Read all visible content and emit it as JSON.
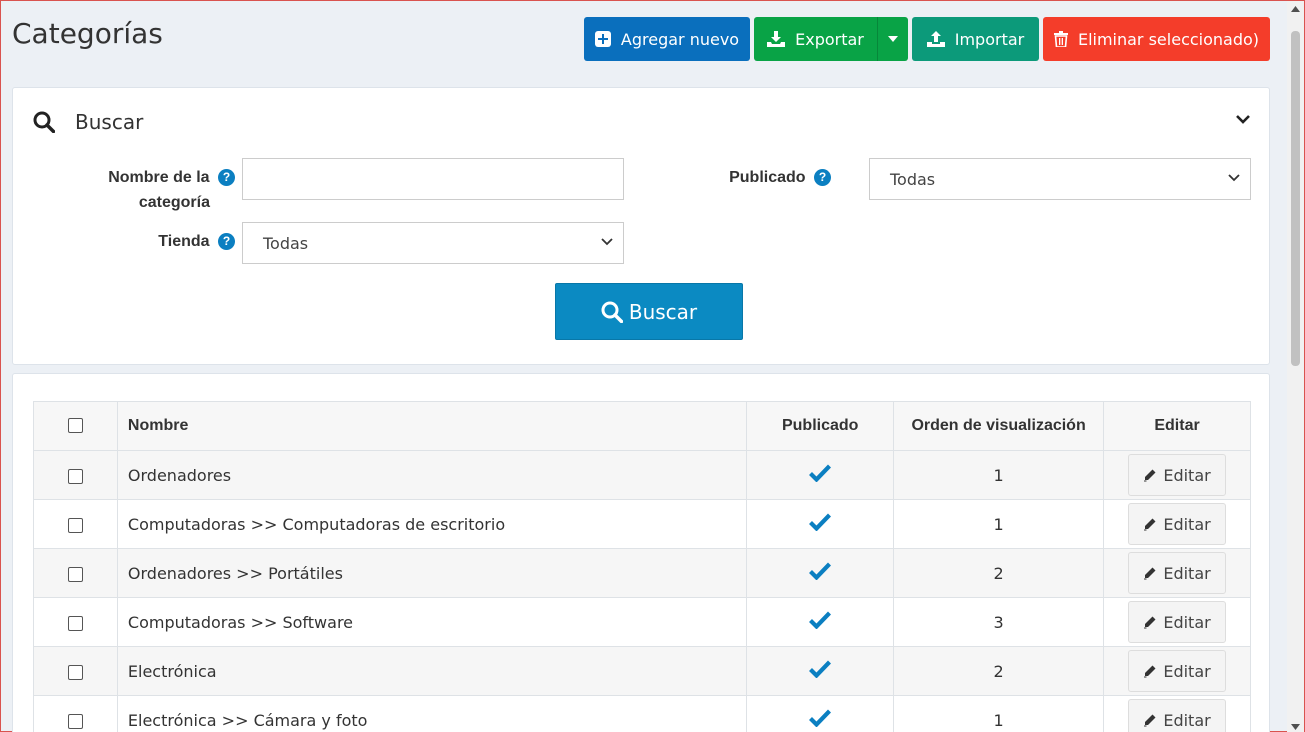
{
  "page": {
    "title": "Categorías"
  },
  "toolbar": {
    "add_label": "Agregar nuevo",
    "export_label": "Exportar",
    "import_label": "Importar",
    "delete_label": "Eliminar seleccionado)"
  },
  "search": {
    "title": "Buscar",
    "category_name_label_1": "Nombre de la",
    "category_name_label_2": "categoría",
    "category_name_value": "",
    "published_label": "Publicado",
    "published_value": "Todas",
    "store_label": "Tienda",
    "store_value": "Todas",
    "button_label": "Buscar",
    "help_glyph": "?"
  },
  "table": {
    "headers": {
      "name": "Nombre",
      "published": "Publicado",
      "display_order": "Orden de visualización",
      "edit": "Editar"
    },
    "edit_label": "Editar",
    "rows": [
      {
        "name": "Ordenadores",
        "published": true,
        "order": "1"
      },
      {
        "name": "Computadoras >> Computadoras de escritorio",
        "published": true,
        "order": "1"
      },
      {
        "name": "Ordenadores >> Portátiles",
        "published": true,
        "order": "2"
      },
      {
        "name": "Computadoras >> Software",
        "published": true,
        "order": "3"
      },
      {
        "name": "Electrónica",
        "published": true,
        "order": "2"
      },
      {
        "name": "Electrónica >> Cámara y foto",
        "published": true,
        "order": "1"
      }
    ]
  },
  "colors": {
    "primary": "#0a6fbd",
    "success": "#09a346",
    "import": "#0c9a7a",
    "danger": "#f43d2a",
    "search": "#0b8ac2",
    "check": "#0b7fc1"
  },
  "icons": {
    "add": "plus-square-icon",
    "export": "download-icon",
    "import": "upload-icon",
    "delete": "trash-icon",
    "search": "search-icon",
    "collapse": "chevron-down-icon",
    "published": "check-icon",
    "edit": "pencil-icon"
  }
}
